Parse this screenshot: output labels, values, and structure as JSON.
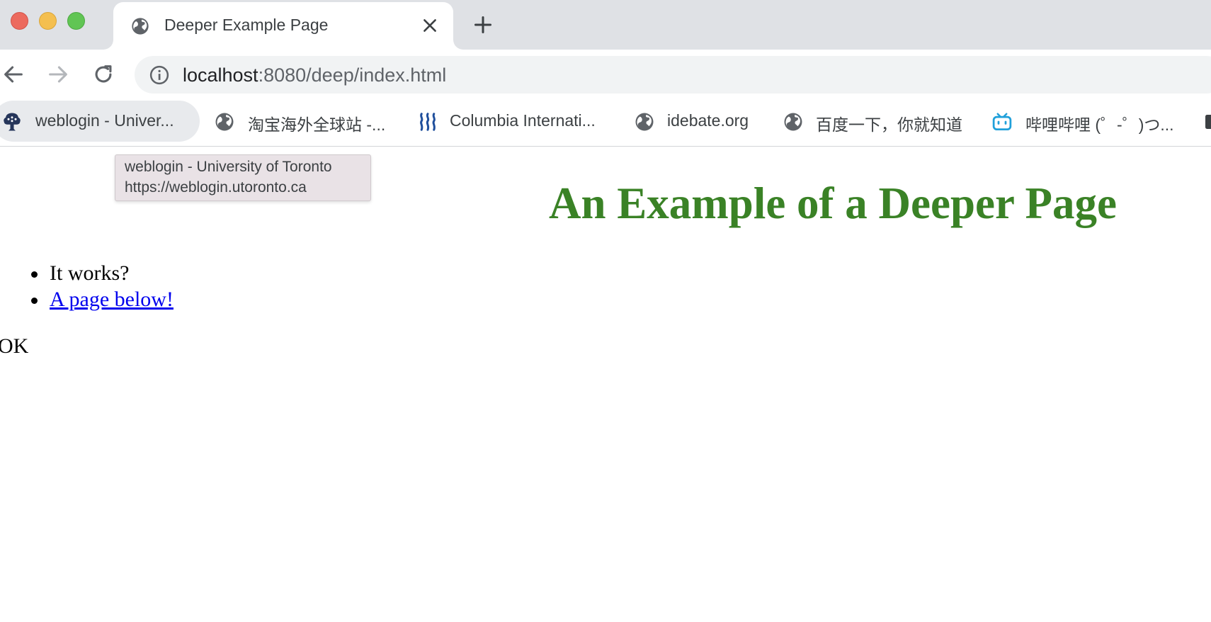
{
  "browser": {
    "tab": {
      "title": "Deeper Example Page",
      "icon": "globe-icon"
    },
    "address_bar": {
      "host": "localhost",
      "rest": ":8080/deep/index.html"
    },
    "bookmarks": [
      {
        "label": "weblogin - Univer...",
        "icon": "uoft-crest-icon"
      },
      {
        "label": "淘宝海外全球站 -...",
        "icon": "globe-icon"
      },
      {
        "label": "Columbia Internati...",
        "icon": "columbia-icon"
      },
      {
        "label": "idebate.org",
        "icon": "globe-icon"
      },
      {
        "label": "百度一下，你就知道",
        "icon": "globe-icon"
      },
      {
        "label": "哔哩哔哩 (゜-゜)つ...",
        "icon": "bilibili-icon"
      }
    ],
    "tooltip": {
      "title": "weblogin - University of Toronto",
      "url": "https://weblogin.utoronto.ca"
    }
  },
  "page": {
    "heading": "An Example of a Deeper Page",
    "list": [
      "It works?",
      "A page below!"
    ],
    "footer_text": "OK"
  },
  "colors": {
    "heading": "#3a8226",
    "link": "#0000ee",
    "tab_strip": "#dfe1e5",
    "omnibox": "#f1f3f4"
  }
}
